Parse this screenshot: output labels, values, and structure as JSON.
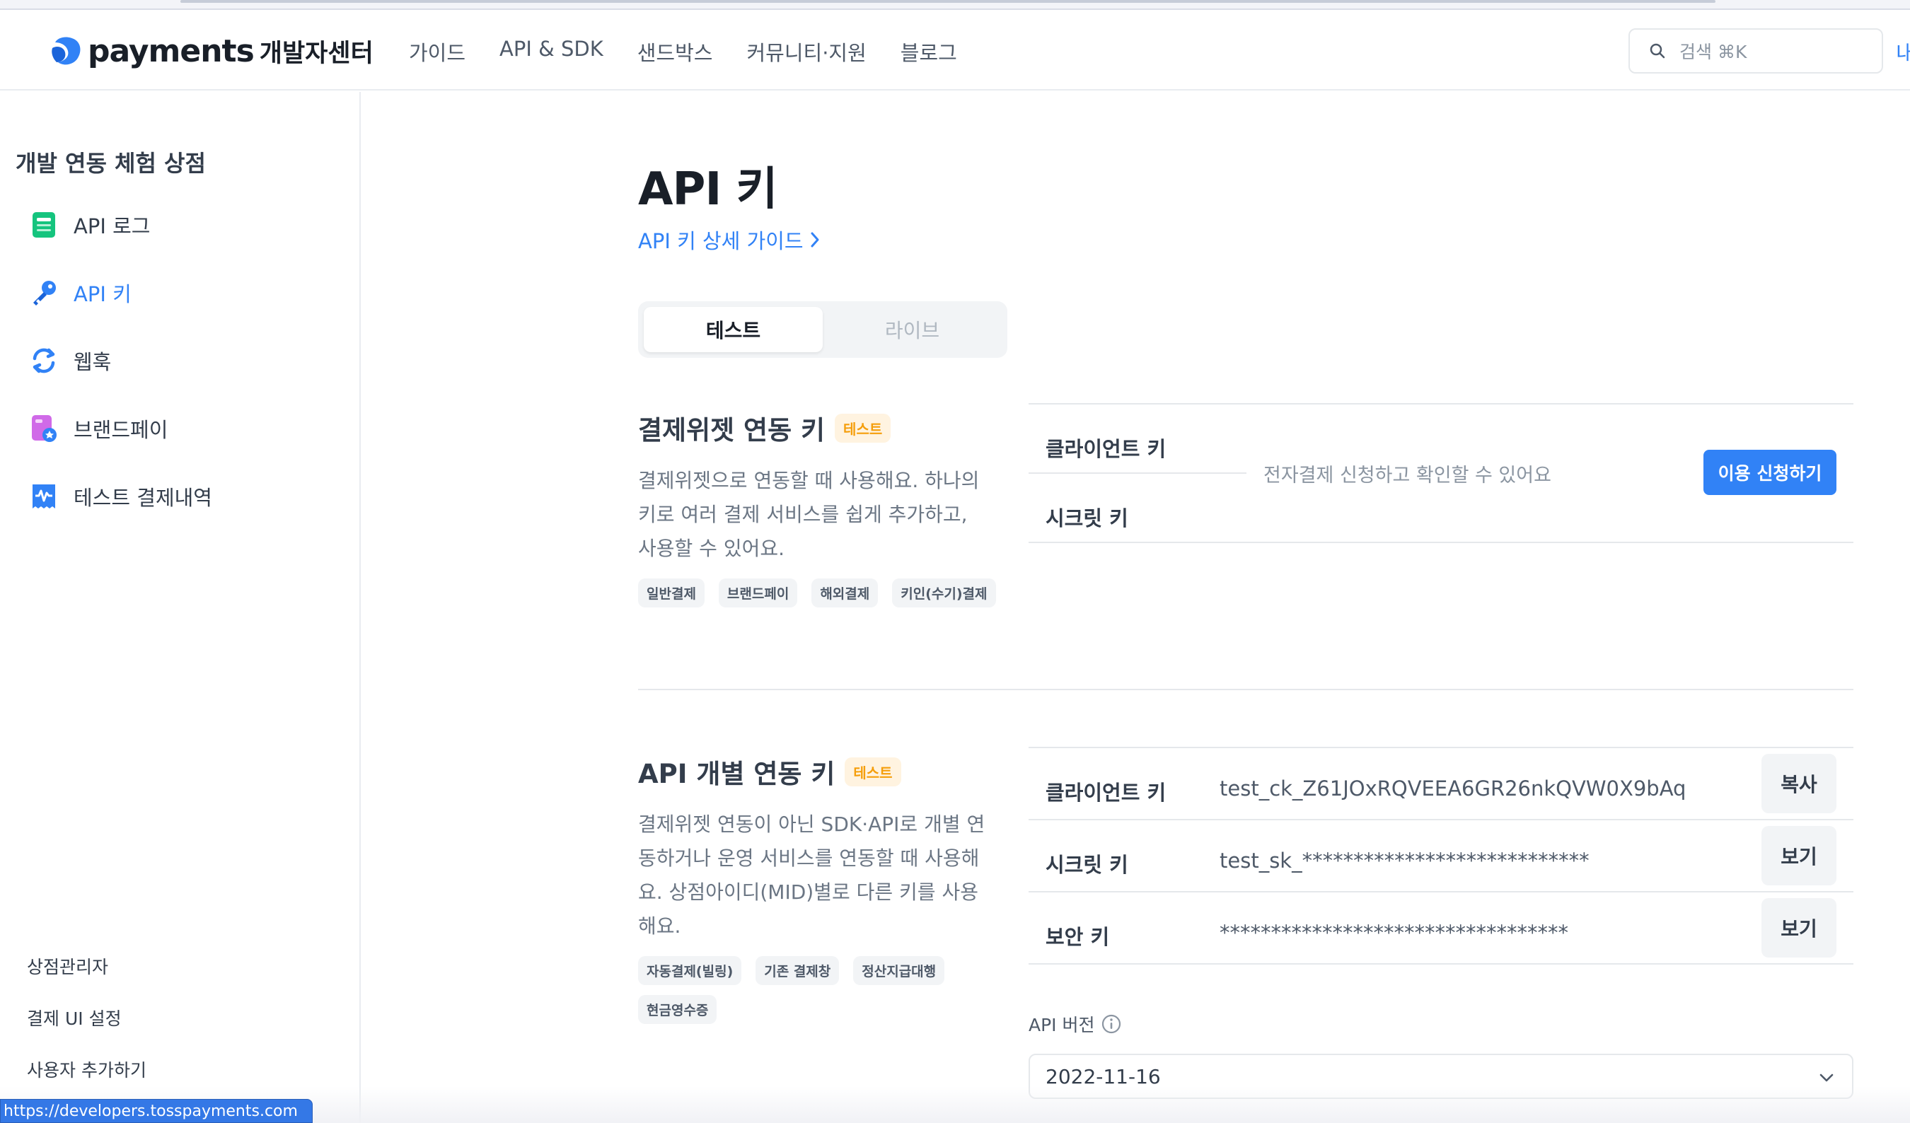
{
  "header": {
    "brand": "payments",
    "brand_sub": "개발자센터",
    "nav": [
      "가이드",
      "API & SDK",
      "샌드박스",
      "커뮤니티·지원",
      "블로그"
    ],
    "search_placeholder": "검색 ⌘K",
    "my_label": "내"
  },
  "sidebar": {
    "title": "개발 연동 체험 상점",
    "items": [
      {
        "label": "API 로그",
        "icon": "document-icon"
      },
      {
        "label": "API 키",
        "icon": "key-icon",
        "active": true
      },
      {
        "label": "웹훅",
        "icon": "refresh-icon"
      },
      {
        "label": "브랜드페이",
        "icon": "brandpay-icon"
      },
      {
        "label": "테스트 결제내역",
        "icon": "receipt-icon"
      }
    ],
    "bottom_links": [
      "상점관리자",
      "결제 UI 설정",
      "사용자 추가하기"
    ]
  },
  "status_url": "https://developers.tosspayments.com",
  "main": {
    "title": "API 키",
    "guide_link": "API 키 상세 가이드",
    "tabs": [
      {
        "label": "테스트",
        "selected": true
      },
      {
        "label": "라이브",
        "selected": false
      }
    ],
    "widget_section": {
      "title": "결제위젯 연동 키",
      "badge": "테스트",
      "description": "결제위젯으로 연동할 때 사용해요. 하나의 키로 여러 결제 서비스를 쉽게 추가하고, 사용할 수 있어요.",
      "chips": [
        "일반결제",
        "브랜드페이",
        "해외결제",
        "키인(수기)결제"
      ],
      "rows": {
        "client_label": "클라이언트 키",
        "secret_label": "시크릿 키",
        "note": "전자결제 신청하고 확인할 수 있어요",
        "apply_button": "이용 신청하기"
      }
    },
    "api_section": {
      "title": "API 개별 연동 키",
      "badge": "테스트",
      "description": "결제위젯 연동이 아닌 SDK·API로 개별 연동하거나 운영 서비스를 연동할 때 사용해요. 상점아이디(MID)별로 다른 키를 사용해요.",
      "chips": [
        "자동결제(빌링)",
        "기존 결제창",
        "정산지급대행",
        "현금영수증"
      ],
      "keys": [
        {
          "label": "클라이언트 키",
          "value": "test_ck_Z61JOxRQVEEA6GR26nkQVW0X9bAq",
          "button": "복사"
        },
        {
          "label": "시크릿 키",
          "value": "test_sk_****************************",
          "button": "보기"
        },
        {
          "label": "보안 키",
          "value": "**********************************",
          "button": "보기"
        }
      ],
      "api_version_label": "API 버전",
      "api_version_value": "2022-11-16"
    }
  },
  "colors": {
    "accent": "#3182f6",
    "badge_text": "#f59e0b",
    "badge_bg": "#fff3e0"
  }
}
